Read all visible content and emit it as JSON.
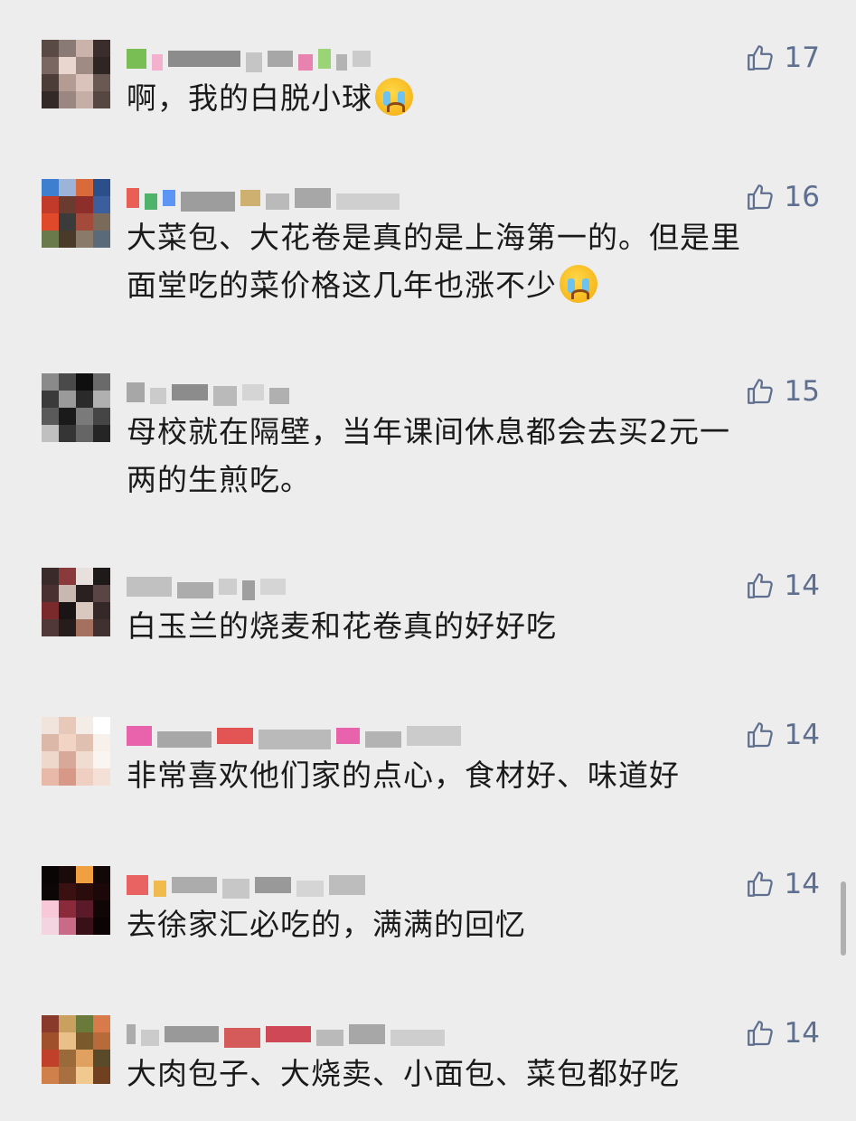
{
  "comments": [
    {
      "text": "啊，我的白脱小球",
      "emoji": "loudly-crying-face",
      "likes": "17",
      "avatar_colors": [
        "#5a4a46",
        "#8a7a75",
        "#c9b3ab",
        "#3a2d2b",
        "#7a6761",
        "#e8d6cf",
        "#a08b84",
        "#2f2624",
        "#4c3d39",
        "#b49c93",
        "#d9c3bb",
        "#6a5853",
        "#332a28",
        "#9b8781",
        "#c4aea6",
        "#574743"
      ],
      "name_colors": [
        "#63b53a",
        "#f3a6c8",
        "#7a7a7a",
        "#bdbdbd",
        "#9a9a9a",
        "#e66fa3",
        "#8ccf60",
        "#a8a8a8",
        "#c4c4c4"
      ]
    },
    {
      "text": "大菜包、大花卷是真的是上海第一的。但是里\n面堂吃的菜价格这几年也涨不少",
      "emoji": "crying-face",
      "likes": "16",
      "avatar_colors": [
        "#3f7fd0",
        "#9bb4d8",
        "#d96a3a",
        "#2b4f8a",
        "#c23b2a",
        "#6a3b2e",
        "#8e2e2a",
        "#3a5f9c",
        "#e04a2a",
        "#3b3b3b",
        "#a34a3a",
        "#7a6a5a",
        "#6b7a4a",
        "#4a3a2a",
        "#8a7a6a",
        "#5a6a7a"
      ],
      "name_colors": [
        "#e8443a",
        "#34a853",
        "#4285f4",
        "#8e8e8e",
        "#c8a45a",
        "#b0b0b0",
        "#9a9a9a",
        "#c9c9c9"
      ]
    },
    {
      "text": "母校就在隔壁，当年课间休息都会去买2元一\n两的生煎吃。",
      "emoji": "",
      "likes": "15",
      "avatar_colors": [
        "#8a8a8a",
        "#4a4a4a",
        "#0f0f0f",
        "#6a6a6a",
        "#3a3a3a",
        "#9a9a9a",
        "#2a2a2a",
        "#b0b0b0",
        "#5a5a5a",
        "#1a1a1a",
        "#7a7a7a",
        "#454545",
        "#c0c0c0",
        "#353535",
        "#656565",
        "#252525"
      ],
      "name_colors": [
        "#9a9a9a",
        "#c4c4c4",
        "#7a7a7a",
        "#b0b0b0",
        "#d0d0d0",
        "#a4a4a4"
      ]
    },
    {
      "text": "白玉兰的烧麦和花卷真的好好吃",
      "emoji": "",
      "likes": "14",
      "avatar_colors": [
        "#3a2a2a",
        "#8a3a3a",
        "#e8e0dc",
        "#1f1a1a",
        "#4a3030",
        "#c8b8b0",
        "#2a2020",
        "#5a4444",
        "#7a2a2a",
        "#1a1414",
        "#d8c8c0",
        "#342828",
        "#503838",
        "#261c1c",
        "#a47060",
        "#403030"
      ],
      "name_colors": [
        "#b8b8b8",
        "#a0a0a0",
        "#c8c8c8",
        "#909090",
        "#d0d0d0"
      ]
    },
    {
      "text": "非常喜欢他们家的点心，食材好、味道好",
      "emoji": "",
      "likes": "14",
      "avatar_colors": [
        "#f0e4dc",
        "#e8c8b8",
        "#f4ece6",
        "#ffffff",
        "#dcb8a8",
        "#f2d4c4",
        "#e0c0b0",
        "#f8f0ea",
        "#eed8cc",
        "#d8a898",
        "#f0dcd0",
        "#fbf5f1",
        "#e8b8a8",
        "#d89888",
        "#eecfc2",
        "#f4e0d6"
      ],
      "name_colors": [
        "#e84aa0",
        "#9a9a9a",
        "#e03a3a",
        "#b0b0b0",
        "#e84aa0",
        "#a8a8a8",
        "#c4c4c4"
      ]
    },
    {
      "text": "去徐家汇必吃的，满满的回忆",
      "emoji": "",
      "likes": "14",
      "avatar_colors": [
        "#0a0505",
        "#1a0a0a",
        "#f0a040",
        "#120808",
        "#0d0606",
        "#3a1010",
        "#2a0c0c",
        "#1c0808",
        "#f8c8d8",
        "#8a2a3a",
        "#5a1a2a",
        "#100606",
        "#f4d4e0",
        "#c86a88",
        "#3a1018",
        "#0c0404"
      ],
      "name_colors": [
        "#e84a4a",
        "#f0b030",
        "#a0a0a0",
        "#c0c0c0",
        "#8a8a8a",
        "#d0d0d0",
        "#b4b4b4"
      ]
    },
    {
      "text": "大肉包子、大烧卖、小面包、菜包都好吃",
      "emoji": "",
      "likes": "14",
      "avatar_colors": [
        "#8a3a2a",
        "#c8a060",
        "#6a7a3a",
        "#d87a4a",
        "#a0502a",
        "#e8c088",
        "#7a5a2a",
        "#b86a3a",
        "#c0402a",
        "#9a6a3a",
        "#e0a060",
        "#5a4a2a",
        "#d0804a",
        "#a87040",
        "#f0c890",
        "#704020"
      ],
      "name_colors": [
        "#a0a0a0",
        "#c4c4c4",
        "#8a8a8a",
        "#d04040",
        "#c82a3a",
        "#b0b0b0",
        "#9a9a9a",
        "#c8c8c8"
      ]
    }
  ],
  "colors": {
    "background": "#ededed",
    "text": "#1a1a1a",
    "like": "#5f6f8f"
  },
  "icons": {
    "like": "thumbs-up-icon"
  }
}
